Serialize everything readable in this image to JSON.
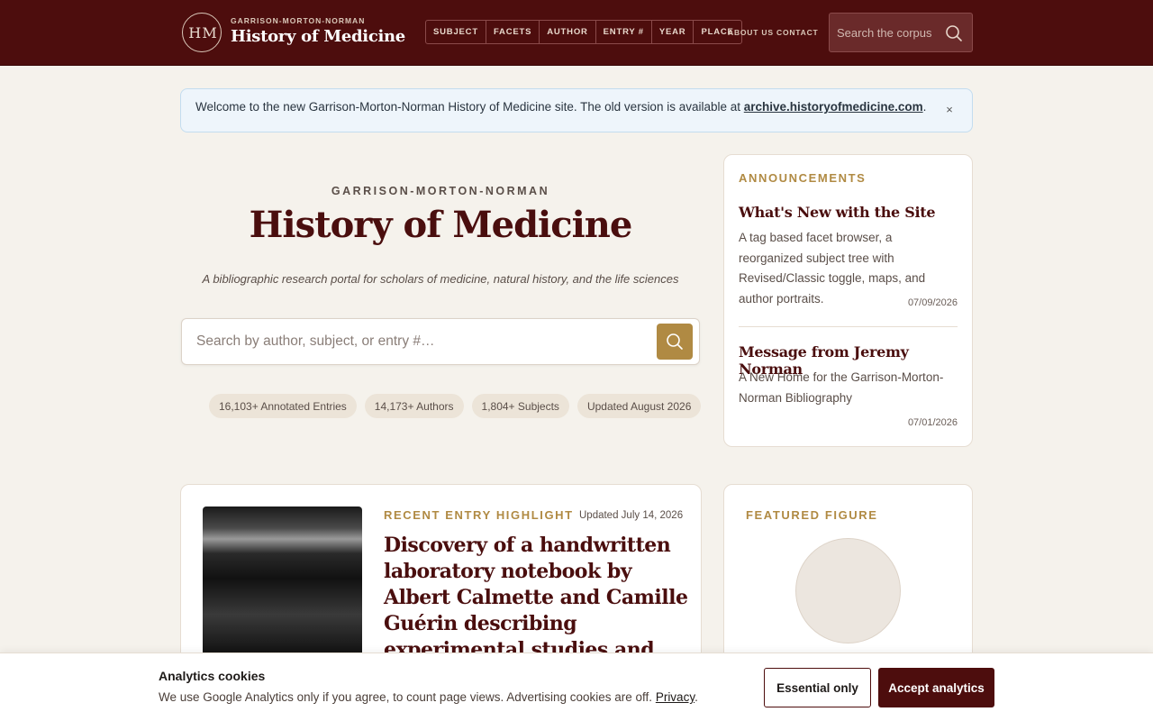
{
  "header": {
    "logo_mark": "H M",
    "logo_small": "GARRISON-MORTON-NORMAN",
    "logo_title": "History of Medicine",
    "nav": [
      "SUBJECT",
      "FACETS",
      "AUTHOR",
      "ENTRY #",
      "YEAR",
      "PLACE"
    ],
    "about": "ABOUT US",
    "contact": "CONTACT",
    "search_placeholder": "Search the corpus"
  },
  "notice": {
    "text": "Welcome to the new Garrison-Morton-Norman History of Medicine site. The old version is available at ",
    "link": "archive.historyofmedicine.com",
    "suffix": ".",
    "close": "×"
  },
  "hero": {
    "small": "GARRISON-MORTON-NORMAN",
    "title": "History of Medicine",
    "subtitle": "A bibliographic research portal for scholars of medicine, natural history, and the life sciences",
    "search_placeholder": "Search by author, subject, or entry #…",
    "stats": [
      "16,103+ Annotated Entries",
      "14,173+ Authors",
      "1,804+ Subjects",
      "Updated August 2026"
    ]
  },
  "announcements": {
    "label": "ANNOUNCEMENTS",
    "items": [
      {
        "title": "What's New with the Site",
        "body": "A tag based facet browser, a reorganized subject tree with Revised/Classic toggle, maps, and author portraits.",
        "date": "07/09/2026"
      },
      {
        "title": "Message from Jeremy Norman",
        "body": "A New Home for the Garrison-Morton-Norman Bibliography",
        "date": "07/01/2026"
      }
    ]
  },
  "highlight": {
    "label": "RECENT ENTRY HIGHLIGHT",
    "date": "Updated July 14, 2026",
    "title": "Discovery of a handwritten laboratory notebook by Albert Calmette and Camille Guérin describing experimental studies and"
  },
  "featured": {
    "label": "FEATURED FIGURE"
  },
  "cookie": {
    "title": "Analytics cookies",
    "body": "We use Google Analytics only if you agree, to count page views. Advertising cookies are off. ",
    "link": "Privacy",
    "suffix": ".",
    "essential": "Essential only",
    "accept": "Accept analytics"
  },
  "colors": {
    "brand": "#4d0d0d",
    "accent": "#b08a43",
    "background": "#f5f2ec"
  }
}
